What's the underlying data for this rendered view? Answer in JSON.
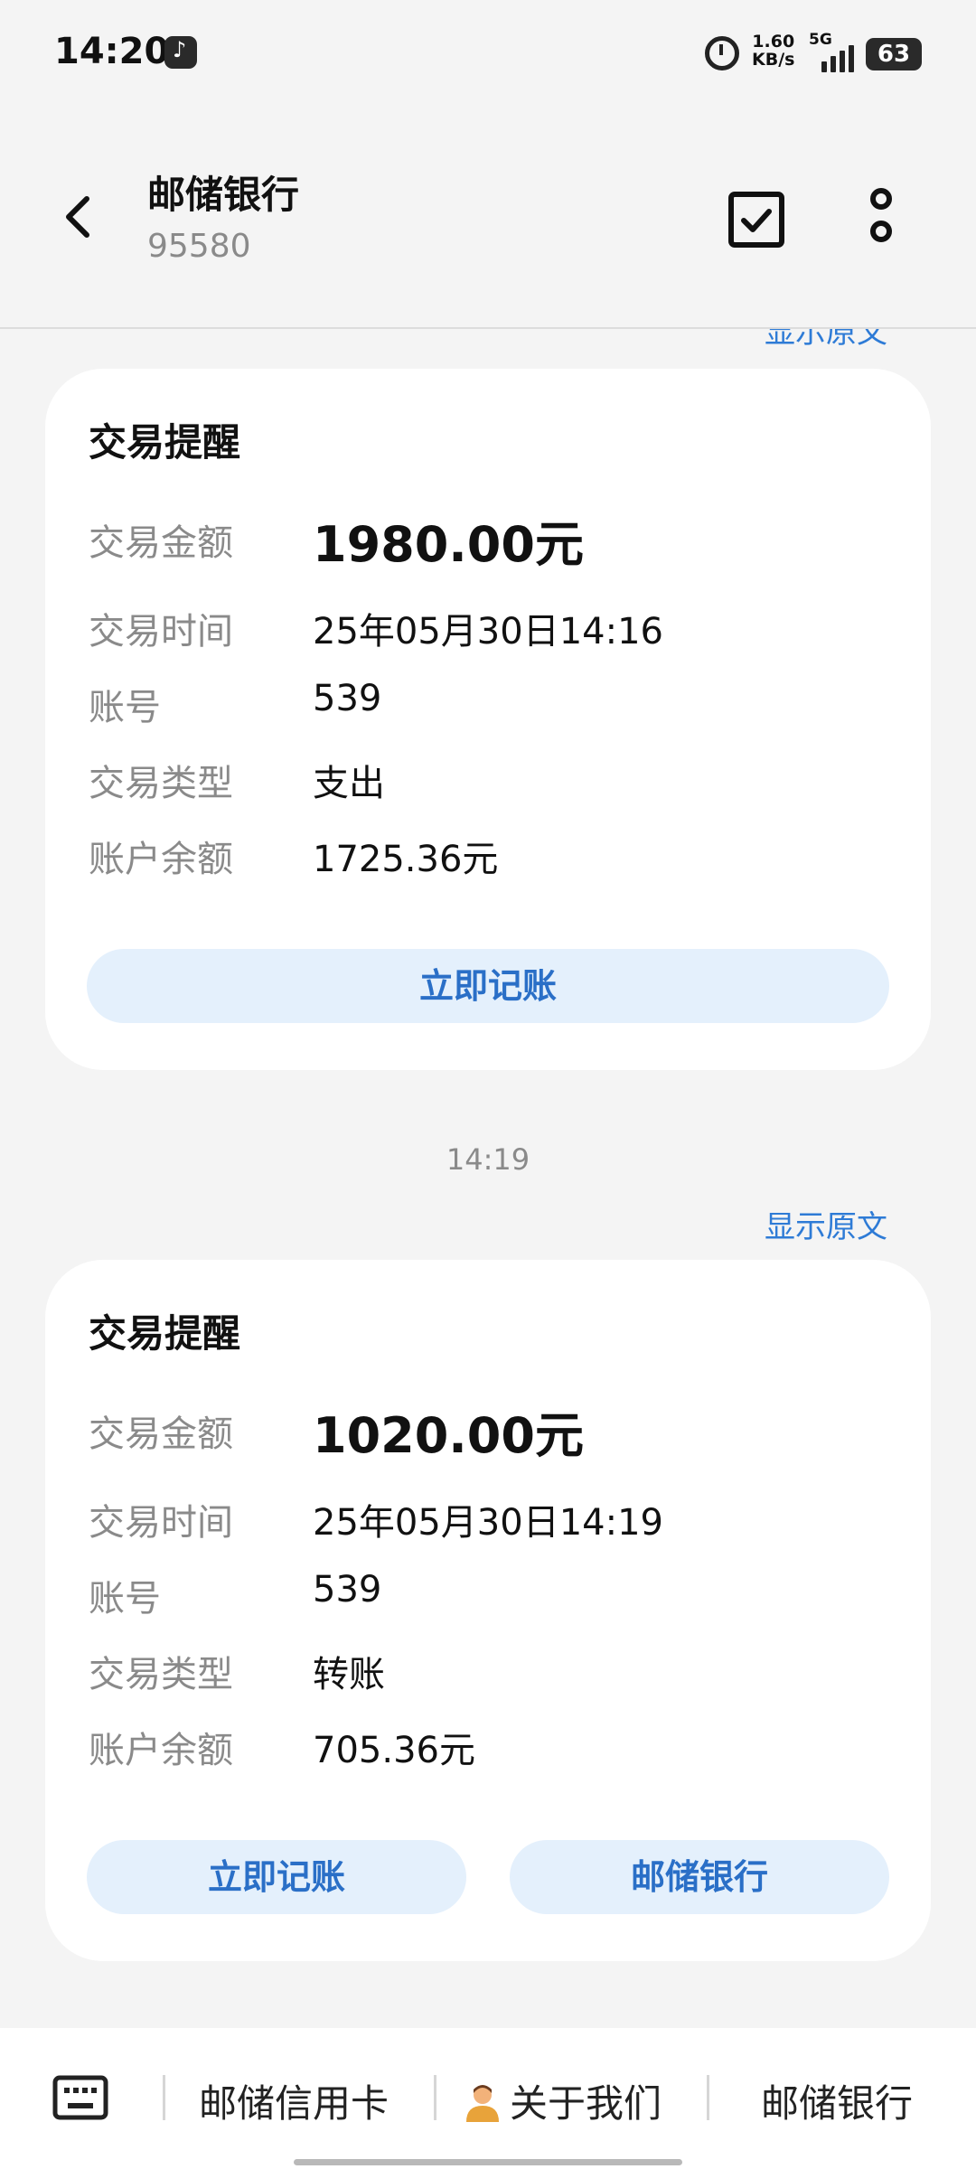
{
  "status": {
    "time": "14:20",
    "net_speed_value": "1.60",
    "net_speed_unit": "KB/s",
    "network": "5G",
    "battery": "63"
  },
  "header": {
    "title": "邮储银行",
    "subtitle": "95580"
  },
  "messages": {
    "show_raw_label": "显示原文",
    "cards": [
      {
        "title": "交易提醒",
        "rows": [
          {
            "label": "交易金额",
            "value": "1980.00元"
          },
          {
            "label": "交易时间",
            "value": "25年05月30日14:16"
          },
          {
            "label": "账号",
            "value": "539"
          },
          {
            "label": "交易类型",
            "value": "支出"
          },
          {
            "label": "账户余额",
            "value": "1725.36元"
          }
        ],
        "actions": [
          "立即记账"
        ]
      },
      {
        "time": "14:19",
        "title": "交易提醒",
        "rows": [
          {
            "label": "交易金额",
            "value": "1020.00元"
          },
          {
            "label": "交易时间",
            "value": "25年05月30日14:19"
          },
          {
            "label": "账号",
            "value": "539"
          },
          {
            "label": "交易类型",
            "value": "转账"
          },
          {
            "label": "账户余额",
            "value": "705.36元"
          }
        ],
        "actions": [
          "立即记账",
          "邮储银行"
        ]
      }
    ]
  },
  "bottom_menu": {
    "items": [
      "邮储信用卡",
      "关于我们",
      "邮储银行"
    ]
  },
  "colors": {
    "accent": "#2e7bd6",
    "button_bg": "#e4f0fc",
    "button_text": "#2a6fc7",
    "background": "#f4f4f4"
  },
  "icons": [
    "tiktok-icon",
    "alarm-icon",
    "back-icon",
    "checkbox-icon",
    "more-vertical-icon",
    "keyboard-icon",
    "person-icon"
  ]
}
